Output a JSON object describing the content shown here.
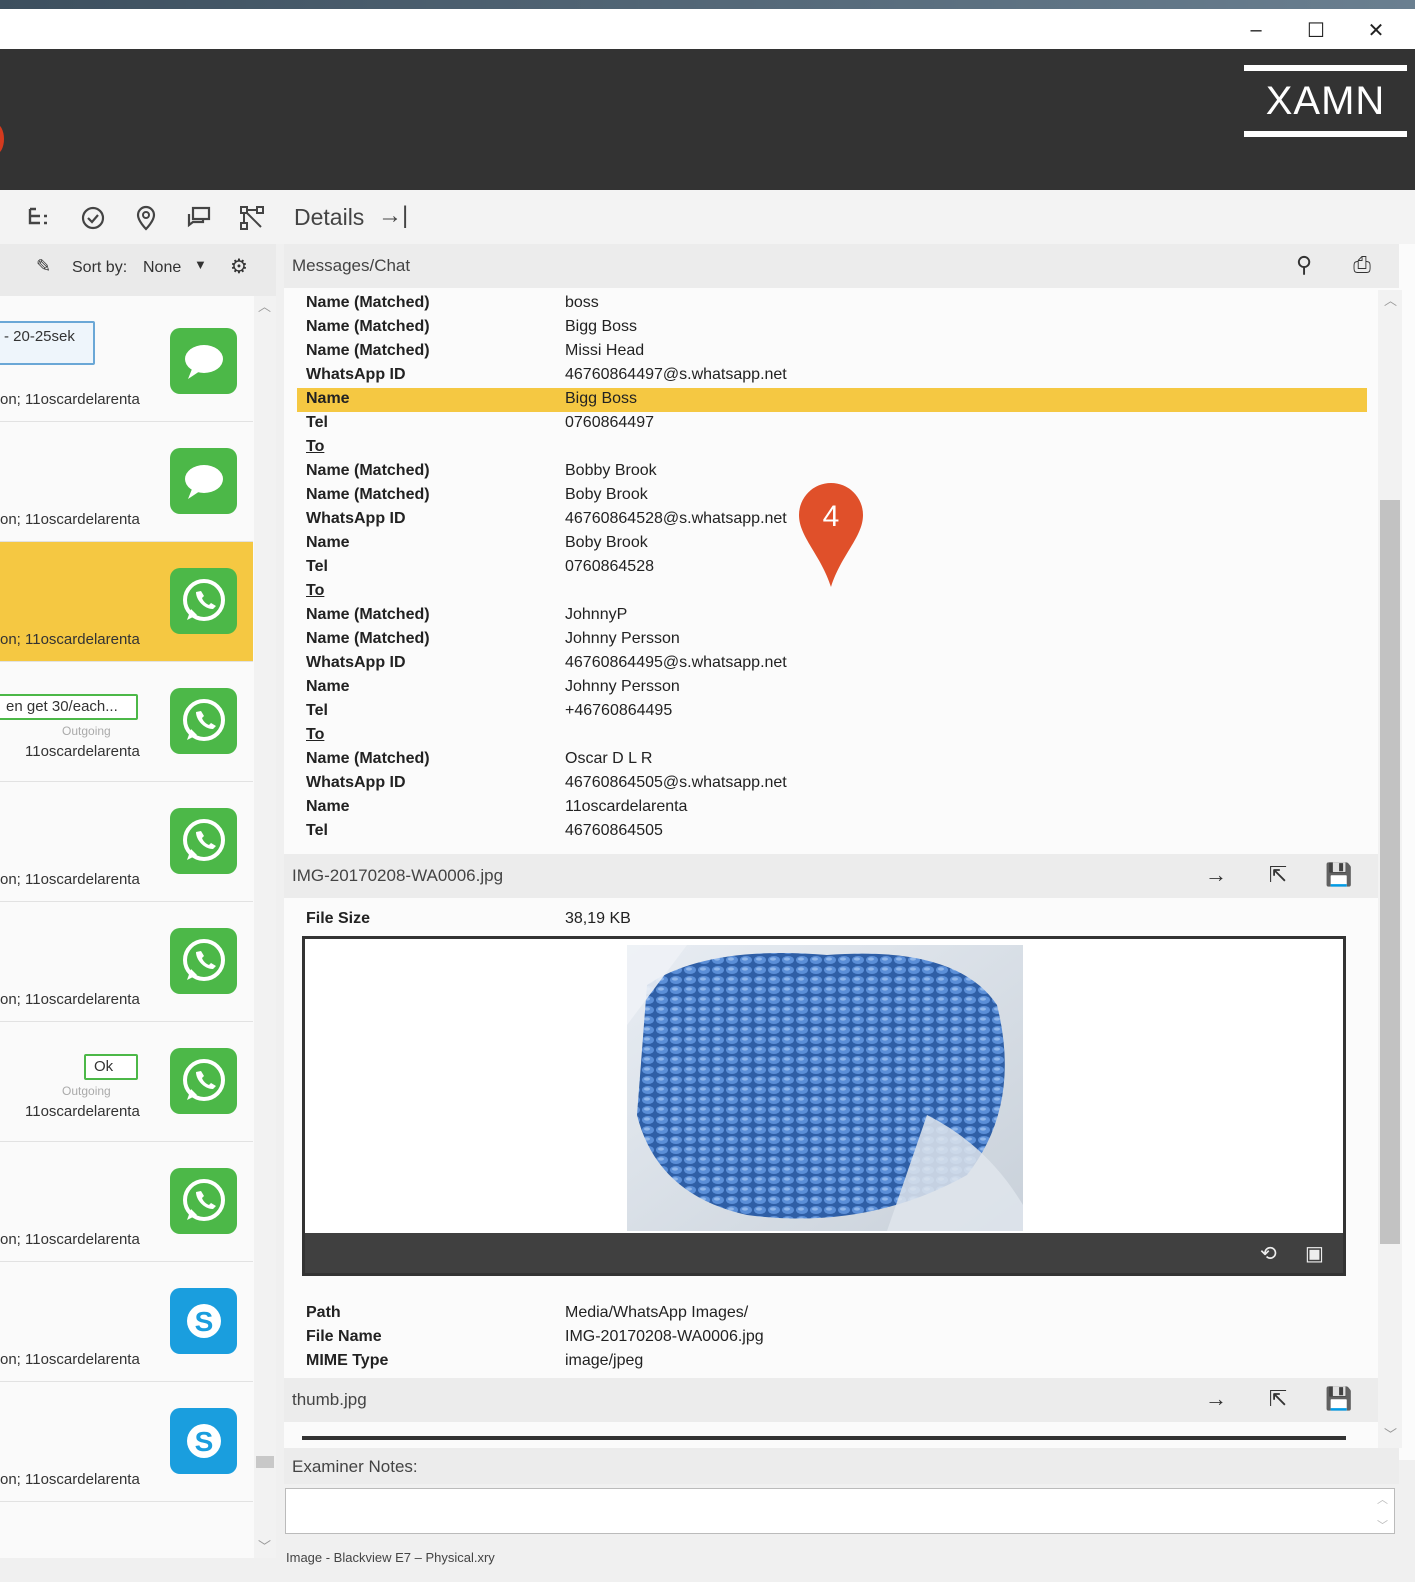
{
  "window": {
    "minimize": "–",
    "maximize": "☐",
    "close": "✕"
  },
  "brand": {
    "logo": "XAMN"
  },
  "toolbar": {
    "details_label": "Details",
    "details_arrow": "→|"
  },
  "sortbar": {
    "label": "Sort by:",
    "value": "None"
  },
  "list": {
    "items": [
      {
        "bubble": "- 20-25sek",
        "owner": "on; 11oscardelarenta",
        "app": "sms-icon"
      },
      {
        "owner": "on; 11oscardelarenta",
        "app": "sms-icon"
      },
      {
        "owner": "on; 11oscardelarenta",
        "app": "whatsapp-icon",
        "selected": true
      },
      {
        "bubble": "en get 30/each...",
        "direction": "Outgoing",
        "owner": "11oscardelarenta",
        "app": "whatsapp-icon"
      },
      {
        "owner": "on; 11oscardelarenta",
        "app": "whatsapp-icon"
      },
      {
        "owner": "on; 11oscardelarenta",
        "app": "whatsapp-icon"
      },
      {
        "bubble": "Ok",
        "direction": "Outgoing",
        "owner": "11oscardelarenta",
        "app": "whatsapp-icon"
      },
      {
        "owner": "on; 11oscardelarenta",
        "app": "whatsapp-icon"
      },
      {
        "owner": "on; 11oscardelarenta",
        "app": "skype-icon"
      },
      {
        "owner": "on; 11oscardelarenta",
        "app": "skype-icon"
      }
    ]
  },
  "details": {
    "section_title": "Messages/Chat",
    "rows": [
      {
        "k": "Name (Matched)",
        "v": "boss"
      },
      {
        "k": "Name (Matched)",
        "v": "Bigg Boss"
      },
      {
        "k": "Name (Matched)",
        "v": "Missi Head"
      },
      {
        "k": "WhatsApp ID",
        "v": "46760864497@s.whatsapp.net"
      },
      {
        "k": "Name",
        "v": "Bigg Boss",
        "highlight": true
      },
      {
        "k": "Tel",
        "v": "0760864497"
      },
      {
        "k": "To",
        "v": "",
        "link": true
      },
      {
        "k": "Name (Matched)",
        "v": "Bobby Brook"
      },
      {
        "k": "Name (Matched)",
        "v": "Boby Brook"
      },
      {
        "k": "WhatsApp ID",
        "v": "46760864528@s.whatsapp.net"
      },
      {
        "k": "Name",
        "v": "Boby Brook"
      },
      {
        "k": "Tel",
        "v": "0760864528"
      },
      {
        "k": "To",
        "v": "",
        "link": true
      },
      {
        "k": "Name (Matched)",
        "v": "JohnnyP"
      },
      {
        "k": "Name (Matched)",
        "v": "Johnny Persson"
      },
      {
        "k": "WhatsApp ID",
        "v": "46760864495@s.whatsapp.net"
      },
      {
        "k": "Name",
        "v": "Johnny Persson"
      },
      {
        "k": "Tel",
        "v": "+46760864495"
      },
      {
        "k": "To",
        "v": "",
        "link": true
      },
      {
        "k": "Name (Matched)",
        "v": "Oscar D L R"
      },
      {
        "k": "WhatsApp ID",
        "v": "46760864505@s.whatsapp.net"
      },
      {
        "k": "Name",
        "v": "11oscardelarenta"
      },
      {
        "k": "Tel",
        "v": "46760864505"
      }
    ],
    "marker_number": "4",
    "attachment": {
      "filename": "IMG-20170208-WA0006.jpg",
      "file_size_label": "File Size",
      "file_size": "38,19 KB",
      "path_label": "Path",
      "path": "Media/WhatsApp Images/",
      "file_name_label": "File Name",
      "file_name": "IMG-20170208-WA0006.jpg",
      "mime_label": "MIME Type",
      "mime": "image/jpeg"
    },
    "thumb": {
      "filename": "thumb.jpg"
    }
  },
  "notes": {
    "label": "Examiner Notes:"
  },
  "status": {
    "text": "Image - Blackview E7 – Physical.xry"
  },
  "colors": {
    "highlight": "#f5c842",
    "header": "#333333",
    "marker": "#e0502a",
    "whatsapp": "#4cb848",
    "skype": "#1a9ede"
  }
}
